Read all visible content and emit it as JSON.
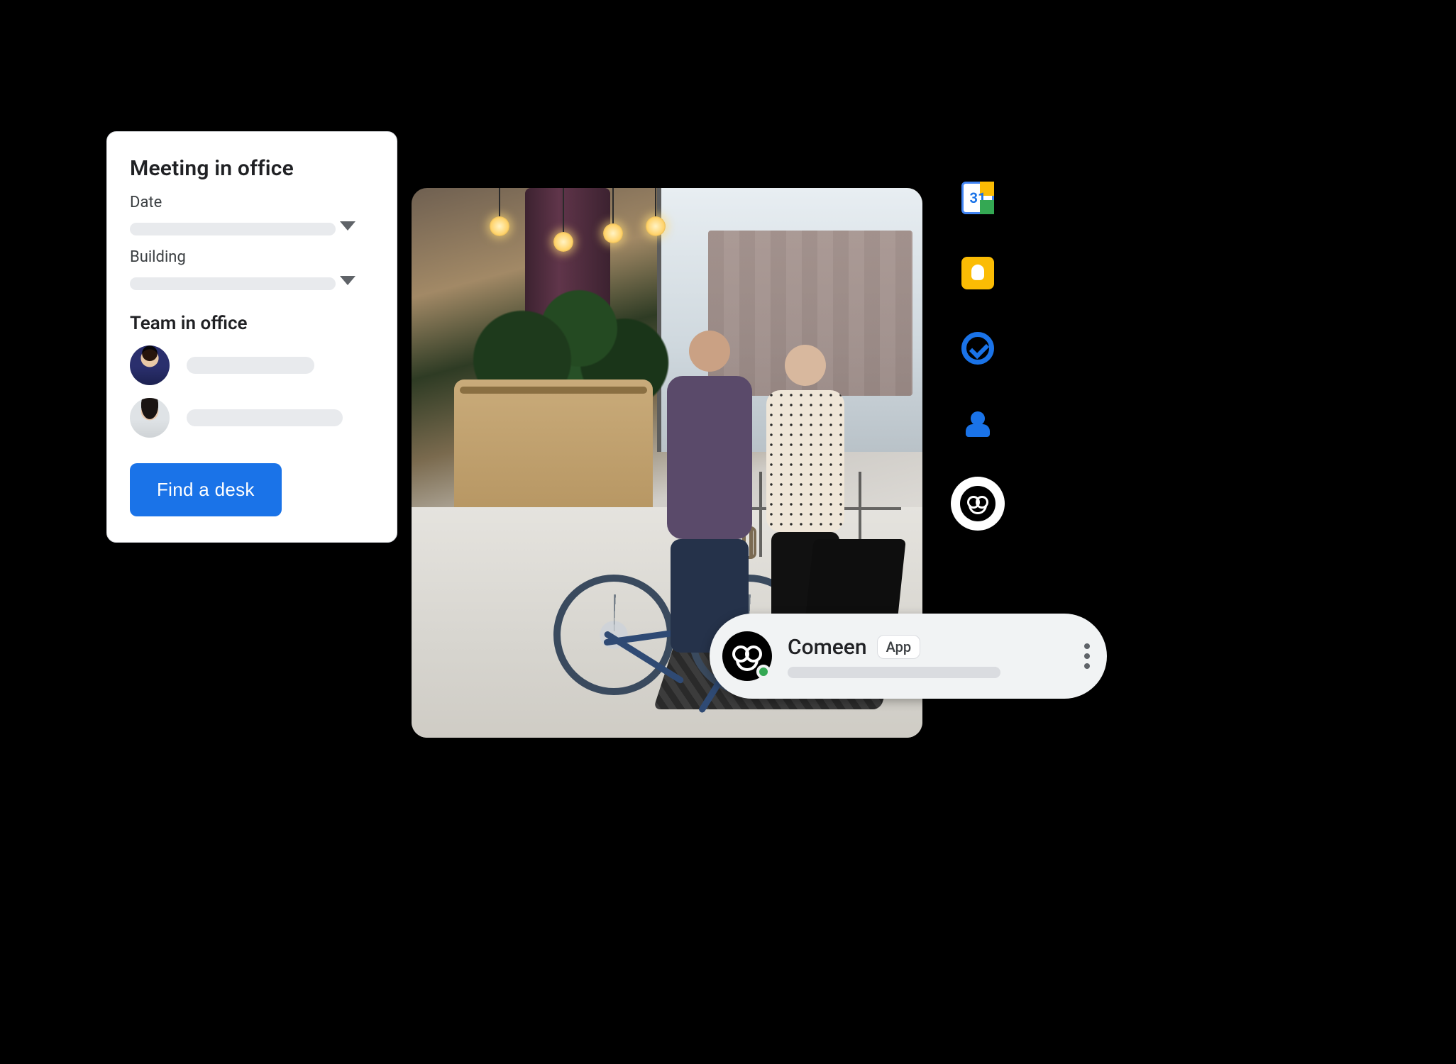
{
  "meeting_card": {
    "title": "Meeting in office",
    "date_label": "Date",
    "building_label": "Building",
    "team_section_title": "Team in office",
    "find_button_label": "Find a desk"
  },
  "side_panel": {
    "calendar_day": "31"
  },
  "chat": {
    "app_name": "Comeen",
    "badge": "App"
  }
}
